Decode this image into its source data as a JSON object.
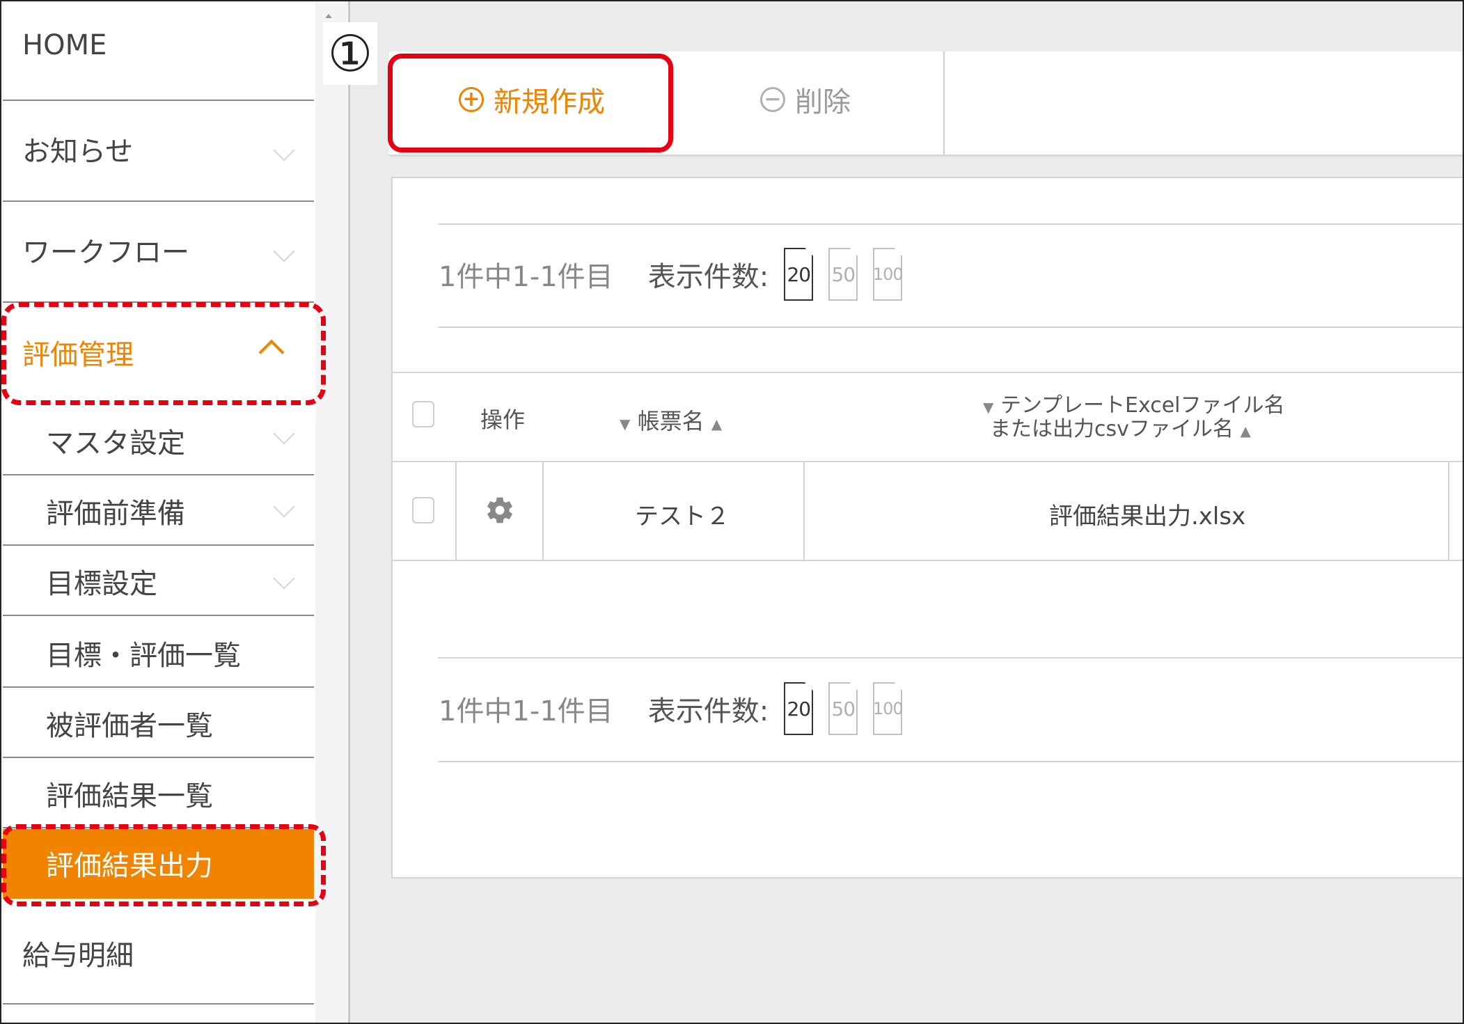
{
  "step": {
    "number": "①"
  },
  "sidebar": {
    "items": [
      {
        "label": "HOME"
      },
      {
        "label": "お知らせ"
      },
      {
        "label": "ワークフロー"
      },
      {
        "label": "評価管理"
      },
      {
        "label": "マスタ設定"
      },
      {
        "label": "評価前準備"
      },
      {
        "label": "目標設定"
      },
      {
        "label": "目標・評価一覧"
      },
      {
        "label": "被評価者一覧"
      },
      {
        "label": "評価結果一覧"
      },
      {
        "label": "評価結果出力"
      },
      {
        "label": "給与明細"
      }
    ],
    "accent_color": "#f08300"
  },
  "toolbar": {
    "new_label": "新規作成",
    "delete_label": "削除"
  },
  "pager_top": {
    "count_text": "1件中1-1件目",
    "per_page_label": "表示件数:",
    "options": [
      "20",
      "50",
      "100"
    ],
    "selected": "20"
  },
  "pager_bottom": {
    "count_text": "1件中1-1件目",
    "per_page_label": "表示件数:",
    "options": [
      "20",
      "50",
      "100"
    ],
    "selected": "20"
  },
  "table": {
    "headers": {
      "operation": "操作",
      "form_name": "帳票名",
      "file_name_line1": "テンプレートExcelファイル名",
      "file_name_line2": "または出力csvファイル名"
    },
    "rows": [
      {
        "form_name": "テスト２",
        "file_name": "評価結果出力.xlsx"
      }
    ]
  },
  "colors": {
    "highlight_red": "#e60012",
    "orange": "#f08300"
  }
}
